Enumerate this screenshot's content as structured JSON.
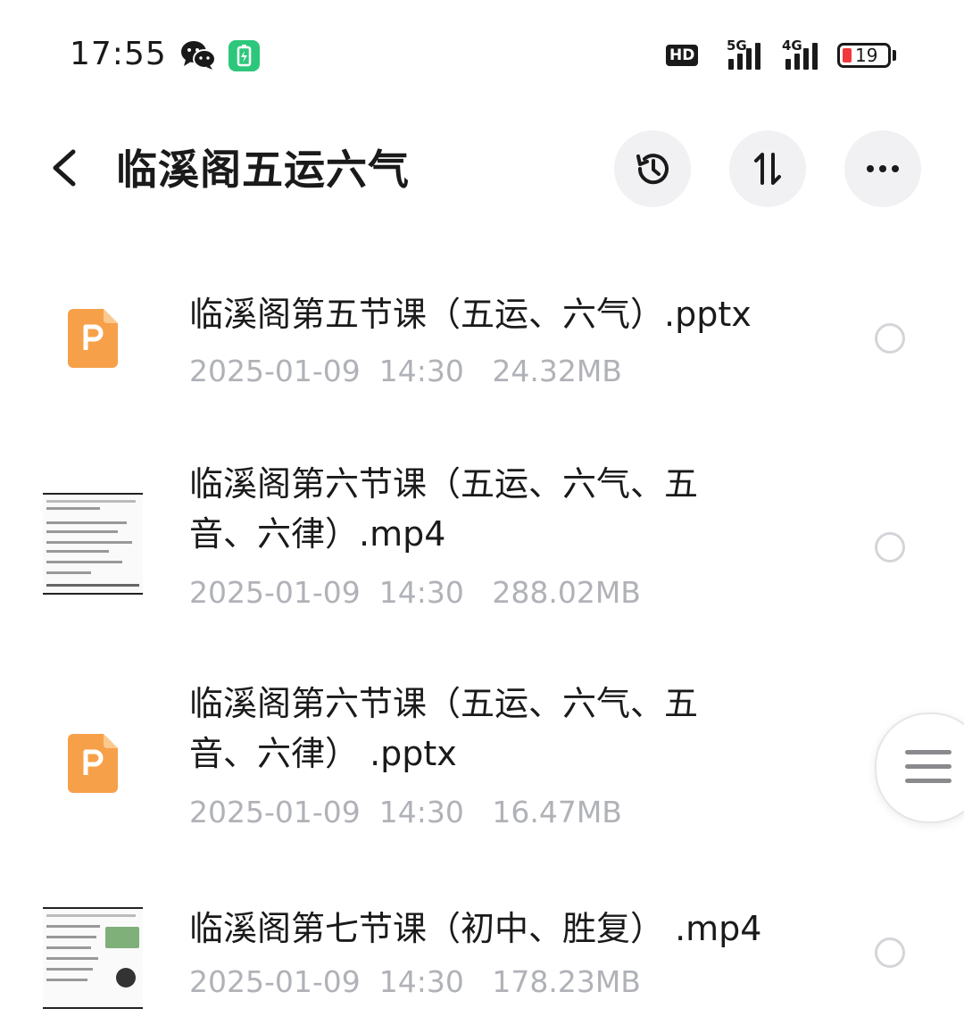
{
  "status_bar": {
    "time": "17:55",
    "hd": "HD",
    "sim1_label": "5G",
    "sim2_label": "4G",
    "battery_level": "19"
  },
  "header": {
    "title": "临溪阁五运六气"
  },
  "files": [
    {
      "name": "临溪阁第五节课（五运、六气）.pptx",
      "date": "2025-01-09  14:30",
      "size": "24.32MB",
      "type": "pptx"
    },
    {
      "name": "临溪阁第六节课（五运、六气、五音、六律）.mp4",
      "date": "2025-01-09  14:30",
      "size": "288.02MB",
      "type": "mp4"
    },
    {
      "name": "临溪阁第六节课（五运、六气、五音、六律） .pptx",
      "date": "2025-01-09  14:30",
      "size": "16.47MB",
      "type": "pptx"
    },
    {
      "name": "临溪阁第七节课（初中、胜复） .mp4",
      "date": "2025-01-09  14:30",
      "size": "178.23MB",
      "type": "mp4"
    }
  ],
  "colors": {
    "ppt_icon": "#f7a04a",
    "meta_text": "#b0b2b8",
    "button_bg": "#f1f1f3",
    "battery_low": "#f0393a"
  },
  "icons": {
    "history": "history-icon",
    "sort": "sort-icon",
    "more": "more-icon",
    "back": "back-icon"
  }
}
